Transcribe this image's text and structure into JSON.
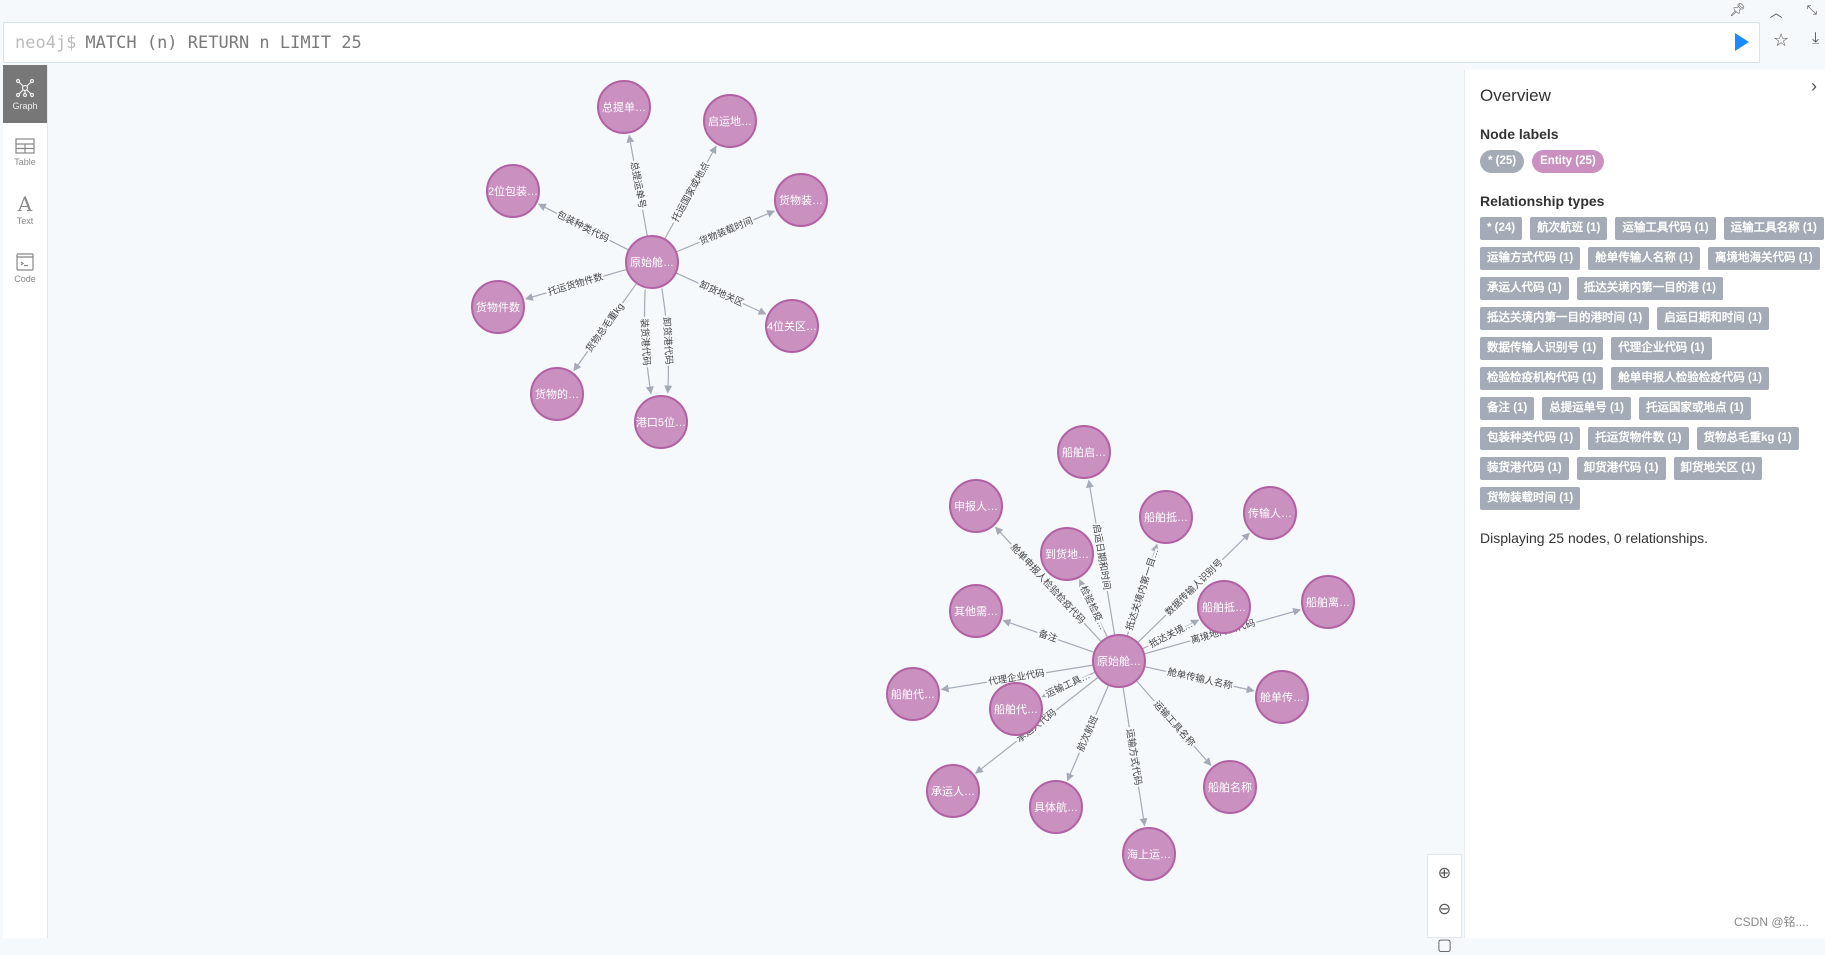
{
  "editor": {
    "prompt": "neo4j$",
    "query": "MATCH (n) RETURN n LIMIT 25"
  },
  "sidebar": {
    "items": [
      {
        "label": "Graph",
        "icon": "graph-icon",
        "active": true
      },
      {
        "label": "Table",
        "icon": "table-icon"
      },
      {
        "label": "Text",
        "icon": "text-icon"
      },
      {
        "label": "Code",
        "icon": "code-icon"
      }
    ]
  },
  "colors": {
    "node": "#c990c0",
    "node_border": "#b261a5",
    "chip": "#a5abb6",
    "run": "#1a8cff",
    "edge": "#a5abb6"
  },
  "graph": {
    "nodes": [
      "原始舱…",
      "总提单…",
      "启运地…",
      "2位包装…",
      "货物装…",
      "货物件数",
      "4位关区…",
      "货物的…",
      "港口5位…",
      "原始舱…",
      "船舶启…",
      "申报人…",
      "到货地…",
      "船舶抵…",
      "传输人…",
      "船舶抵…",
      "船舶离…",
      "其他需…",
      "船舶代…",
      "船舶代…",
      "舱单传…",
      "承运人…",
      "具体航…",
      "船舶名称",
      "海上运…"
    ],
    "edges": [
      {
        "from": 0,
        "to": 1,
        "label": "总提运单号"
      },
      {
        "from": 0,
        "to": 2,
        "label": "托运国家或地点"
      },
      {
        "from": 0,
        "to": 3,
        "label": "包装种类代码"
      },
      {
        "from": 0,
        "to": 4,
        "label": "货物装载时间"
      },
      {
        "from": 0,
        "to": 5,
        "label": "托运货物件数"
      },
      {
        "from": 0,
        "to": 6,
        "label": "卸货地关区"
      },
      {
        "from": 0,
        "to": 7,
        "label": "货物总毛重kg"
      },
      {
        "from": 0,
        "to": 8,
        "label": "卸货港代码"
      },
      {
        "from": 0,
        "to": 8,
        "label": "装货港代码"
      },
      {
        "from": 9,
        "to": 10,
        "label": "启运日期和时间"
      },
      {
        "from": 9,
        "to": 11,
        "label": "舱单申报人检验检疫代码"
      },
      {
        "from": 9,
        "to": 12,
        "label": "检验检疫…"
      },
      {
        "from": 9,
        "to": 13,
        "label": "抵达关境内第一目…"
      },
      {
        "from": 9,
        "to": 14,
        "label": "数据传输人识别号"
      },
      {
        "from": 9,
        "to": 15,
        "label": "抵达关境…"
      },
      {
        "from": 9,
        "to": 16,
        "label": "离境地海关代码"
      },
      {
        "from": 9,
        "to": 17,
        "label": "备注"
      },
      {
        "from": 9,
        "to": 18,
        "label": "代理企业代码"
      },
      {
        "from": 9,
        "to": 19,
        "label": "运输工具…"
      },
      {
        "from": 9,
        "to": 20,
        "label": "舱单传输人名称"
      },
      {
        "from": 9,
        "to": 21,
        "label": "承运人代码"
      },
      {
        "from": 9,
        "to": 22,
        "label": "航次航班"
      },
      {
        "from": 9,
        "to": 23,
        "label": "运输工具名称"
      },
      {
        "from": 9,
        "to": 24,
        "label": "运输方式代码"
      }
    ]
  },
  "overview": {
    "title": "Overview",
    "node_labels_heading": "Node labels",
    "node_labels": [
      "* (25)",
      "Entity (25)"
    ],
    "rel_heading": "Relationship types",
    "rel_types": [
      "* (24)",
      "航次航班 (1)",
      "运输工具代码 (1)",
      "运输工具名称 (1)",
      "运输方式代码 (1)",
      "舱单传输人名称 (1)",
      "离境地海关代码 (1)",
      "承运人代码 (1)",
      "抵达关境内第一目的港 (1)",
      "抵达关境内第一目的港时间 (1)",
      "启运日期和时间 (1)",
      "数据传输人识别号 (1)",
      "代理企业代码 (1)",
      "检验检疫机构代码 (1)",
      "舱单申报人检验检疫代码 (1)",
      "备注 (1)",
      "总提运单号 (1)",
      "托运国家或地点 (1)",
      "包装种类代码 (1)",
      "托运货物件数 (1)",
      "货物总毛重kg (1)",
      "装货港代码 (1)",
      "卸货港代码 (1)",
      "卸货地关区 (1)",
      "货物装载时间 (1)"
    ],
    "summary": "Displaying 25 nodes, 0 relationships."
  },
  "watermark": "CSDN @铭...."
}
